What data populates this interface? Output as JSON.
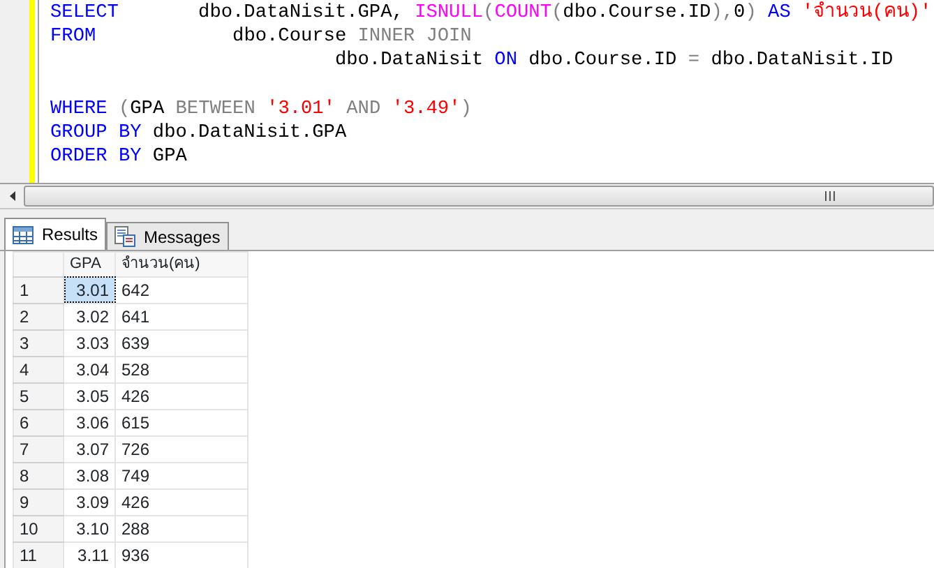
{
  "editor": {
    "lines": [
      {
        "gap_before": false,
        "tokens": [
          {
            "kind": "keyword",
            "text": "SELECT"
          },
          {
            "kind": "plain",
            "text": "       dbo.DataNisit.GPA, "
          },
          {
            "kind": "function",
            "text": "ISNULL"
          },
          {
            "kind": "operator",
            "text": "("
          },
          {
            "kind": "function",
            "text": "COUNT"
          },
          {
            "kind": "operator",
            "text": "("
          },
          {
            "kind": "plain",
            "text": "dbo.Course.ID"
          },
          {
            "kind": "operator",
            "text": "),"
          },
          {
            "kind": "plain",
            "text": "0"
          },
          {
            "kind": "operator",
            "text": ") "
          },
          {
            "kind": "keyword",
            "text": "AS "
          },
          {
            "kind": "string",
            "text": "'จำนวน(คน)'"
          }
        ]
      },
      {
        "gap_before": false,
        "tokens": [
          {
            "kind": "keyword",
            "text": "FROM"
          },
          {
            "kind": "plain",
            "text": "            dbo.Course "
          },
          {
            "kind": "operator",
            "text": "INNER JOIN"
          }
        ]
      },
      {
        "gap_before": false,
        "tokens": [
          {
            "kind": "plain",
            "text": "                         dbo.DataNisit "
          },
          {
            "kind": "keyword",
            "text": "ON"
          },
          {
            "kind": "plain",
            "text": " dbo.Course.ID "
          },
          {
            "kind": "operator",
            "text": "="
          },
          {
            "kind": "plain",
            "text": " dbo.DataNisit.ID"
          }
        ]
      },
      {
        "gap_before": true,
        "tokens": [
          {
            "kind": "keyword",
            "text": "WHERE"
          },
          {
            "kind": "operator",
            "text": " ("
          },
          {
            "kind": "plain",
            "text": "GPA "
          },
          {
            "kind": "operator",
            "text": "BETWEEN "
          },
          {
            "kind": "string",
            "text": "'3.01' "
          },
          {
            "kind": "operator",
            "text": "AND "
          },
          {
            "kind": "string",
            "text": "'3.49'"
          },
          {
            "kind": "operator",
            "text": ")"
          }
        ]
      },
      {
        "gap_before": false,
        "tokens": [
          {
            "kind": "keyword",
            "text": "GROUP BY"
          },
          {
            "kind": "plain",
            "text": " dbo.DataNisit.GPA"
          }
        ]
      },
      {
        "gap_before": false,
        "tokens": [
          {
            "kind": "keyword",
            "text": "ORDER BY"
          },
          {
            "kind": "plain",
            "text": " GPA"
          }
        ]
      }
    ]
  },
  "tabs": [
    {
      "label": "Results",
      "selected": true,
      "kind": "grid"
    },
    {
      "label": "Messages",
      "selected": false,
      "kind": "messages"
    }
  ],
  "results": {
    "columns": [
      "GPA",
      "จำนวน(คน)"
    ],
    "rows": [
      {
        "number": "1",
        "gpa": "3.01",
        "count": "642",
        "selected": true
      },
      {
        "number": "2",
        "gpa": "3.02",
        "count": "641",
        "selected": false
      },
      {
        "number": "3",
        "gpa": "3.03",
        "count": "639",
        "selected": false
      },
      {
        "number": "4",
        "gpa": "3.04",
        "count": "528",
        "selected": false
      },
      {
        "number": "5",
        "gpa": "3.05",
        "count": "426",
        "selected": false
      },
      {
        "number": "6",
        "gpa": "3.06",
        "count": "615",
        "selected": false
      },
      {
        "number": "7",
        "gpa": "3.07",
        "count": "726",
        "selected": false
      },
      {
        "number": "8",
        "gpa": "3.08",
        "count": "749",
        "selected": false
      },
      {
        "number": "9",
        "gpa": "3.09",
        "count": "426",
        "selected": false
      },
      {
        "number": "10",
        "gpa": "3.10",
        "count": "288",
        "selected": false
      },
      {
        "number": "11",
        "gpa": "3.11",
        "count": "936",
        "selected": false
      }
    ]
  }
}
